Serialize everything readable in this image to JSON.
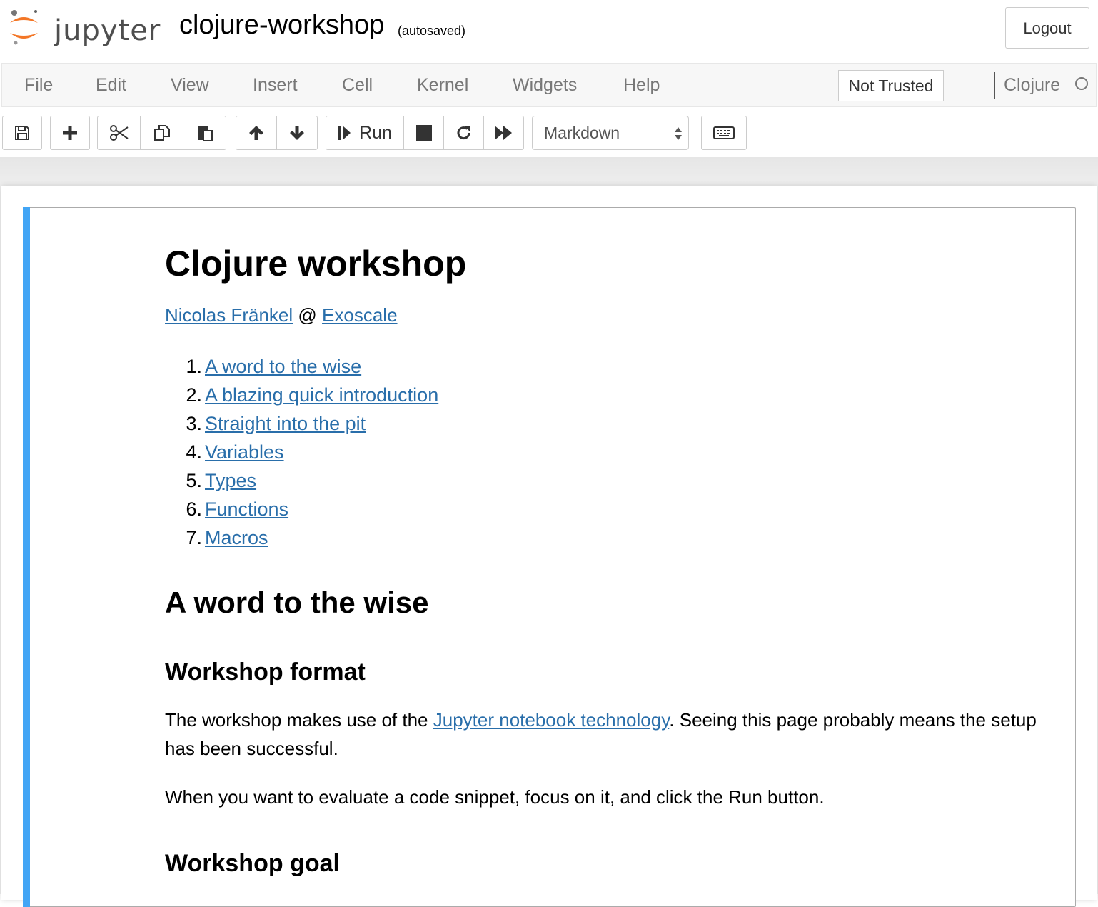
{
  "header": {
    "logo_text": "jupyter",
    "notebook_name": "clojure-workshop",
    "autosave_status": "(autosaved)",
    "logout_label": "Logout"
  },
  "menubar": {
    "items": [
      "File",
      "Edit",
      "View",
      "Insert",
      "Cell",
      "Kernel",
      "Widgets",
      "Help"
    ],
    "trust_label": "Not Trusted",
    "kernel_name": "Clojure"
  },
  "toolbar": {
    "icons": [
      "save-icon",
      "add-cell-icon",
      "cut-icon",
      "copy-icon",
      "paste-icon",
      "move-up-icon",
      "move-down-icon",
      "run-icon",
      "stop-icon",
      "restart-icon",
      "fast-forward-icon",
      "keyboard-icon"
    ],
    "run_label": "Run",
    "cell_type": "Markdown"
  },
  "cell": {
    "title": "Clojure workshop",
    "author": "Nicolas Fränkel",
    "at": "@",
    "company": "Exoscale",
    "toc": [
      {
        "num": "1.",
        "label": "A word to the wise"
      },
      {
        "num": "2.",
        "label": "A blazing quick introduction"
      },
      {
        "num": "3.",
        "label": "Straight into the pit"
      },
      {
        "num": "4.",
        "label": "Variables"
      },
      {
        "num": "5.",
        "label": "Types"
      },
      {
        "num": "6.",
        "label": "Functions"
      },
      {
        "num": "7.",
        "label": "Macros"
      }
    ],
    "section_title": "A word to the wise",
    "subsection_format": "Workshop format",
    "para1_before": "The workshop makes use of the ",
    "para1_link": "Jupyter notebook technology",
    "para1_after": ". Seeing this page probably means the setup has been successful.",
    "para2": "When you want to evaluate a code snippet, focus on it, and click the Run button.",
    "subsection_goal": "Workshop goal"
  },
  "colors": {
    "accent_bar": "#42a5f5",
    "link": "#296eaa",
    "logo_orange": "#f37626"
  }
}
